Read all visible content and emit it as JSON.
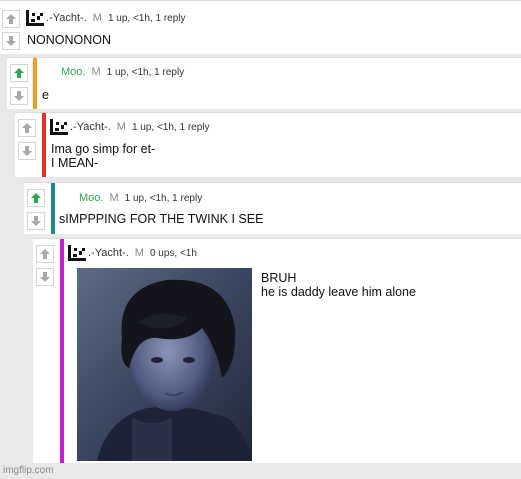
{
  "colors": {
    "upvote_active": "#2fa84f",
    "bar_orange": "#f29b1f",
    "bar_red": "#e4312b",
    "bar_teal": "#1a8c8c",
    "bar_magenta": "#c21fd3"
  },
  "comments": [
    {
      "username": ".-Yacht-.",
      "mod_badge": "M",
      "stats": "1 up, <1h, 1 reply",
      "text": "NONONONON",
      "upvoted": false,
      "has_avatar": true
    },
    {
      "username": "Moo.",
      "mod_badge": "M",
      "stats": "1 up, <1h, 1 reply",
      "text": "e",
      "upvoted": true,
      "has_avatar": false
    },
    {
      "username": ".-Yacht-.",
      "mod_badge": "M",
      "stats": "1 up, <1h, 1 reply",
      "text_lines": [
        "Ima go simp for et-",
        "I MEAN-"
      ],
      "upvoted": false,
      "has_avatar": true
    },
    {
      "username": "Moo.",
      "mod_badge": "M",
      "stats": "1 up, <1h, 1 reply",
      "text": "sIMPPPING FOR THE TWINK I SEE",
      "upvoted": true,
      "has_avatar": false
    },
    {
      "username": ".-Yacht-.",
      "mod_badge": "M",
      "stats": "0 ups, <1h",
      "text_lines": [
        "BRUH",
        "he is daddy leave him alone"
      ],
      "upvoted": false,
      "has_avatar": true,
      "image": "photo-of-dark-haired-young-man"
    }
  ],
  "watermark": "imgflip.com"
}
